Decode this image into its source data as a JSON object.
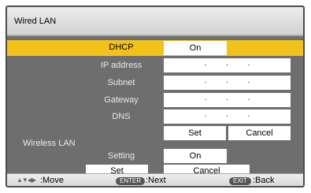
{
  "header": {
    "title": "Wired LAN"
  },
  "wired": {
    "dhcp": {
      "label": "DHCP",
      "value": "On"
    },
    "ip_address": {
      "label": "IP address",
      "value": ". . ."
    },
    "subnet": {
      "label": "Subnet",
      "value": ". . ."
    },
    "gateway": {
      "label": "Gateway",
      "value": ". . ."
    },
    "dns": {
      "label": "DNS",
      "value": ". . ."
    },
    "set_label": "Set",
    "cancel_label": "Cancel"
  },
  "wireless": {
    "section_title": "Wireless LAN",
    "setting": {
      "label": "Setting",
      "value": "On"
    },
    "set_label": "Set",
    "cancel_label": "Cancel"
  },
  "footer": {
    "move_label": ":Move",
    "enter_key": "ENTER",
    "next_label": ":Next",
    "exit_key": "EXIT",
    "back_label": ":Back"
  },
  "colors": {
    "highlight": "#f2c21a",
    "panel": "#6e6e6e",
    "field": "#ffffff"
  }
}
